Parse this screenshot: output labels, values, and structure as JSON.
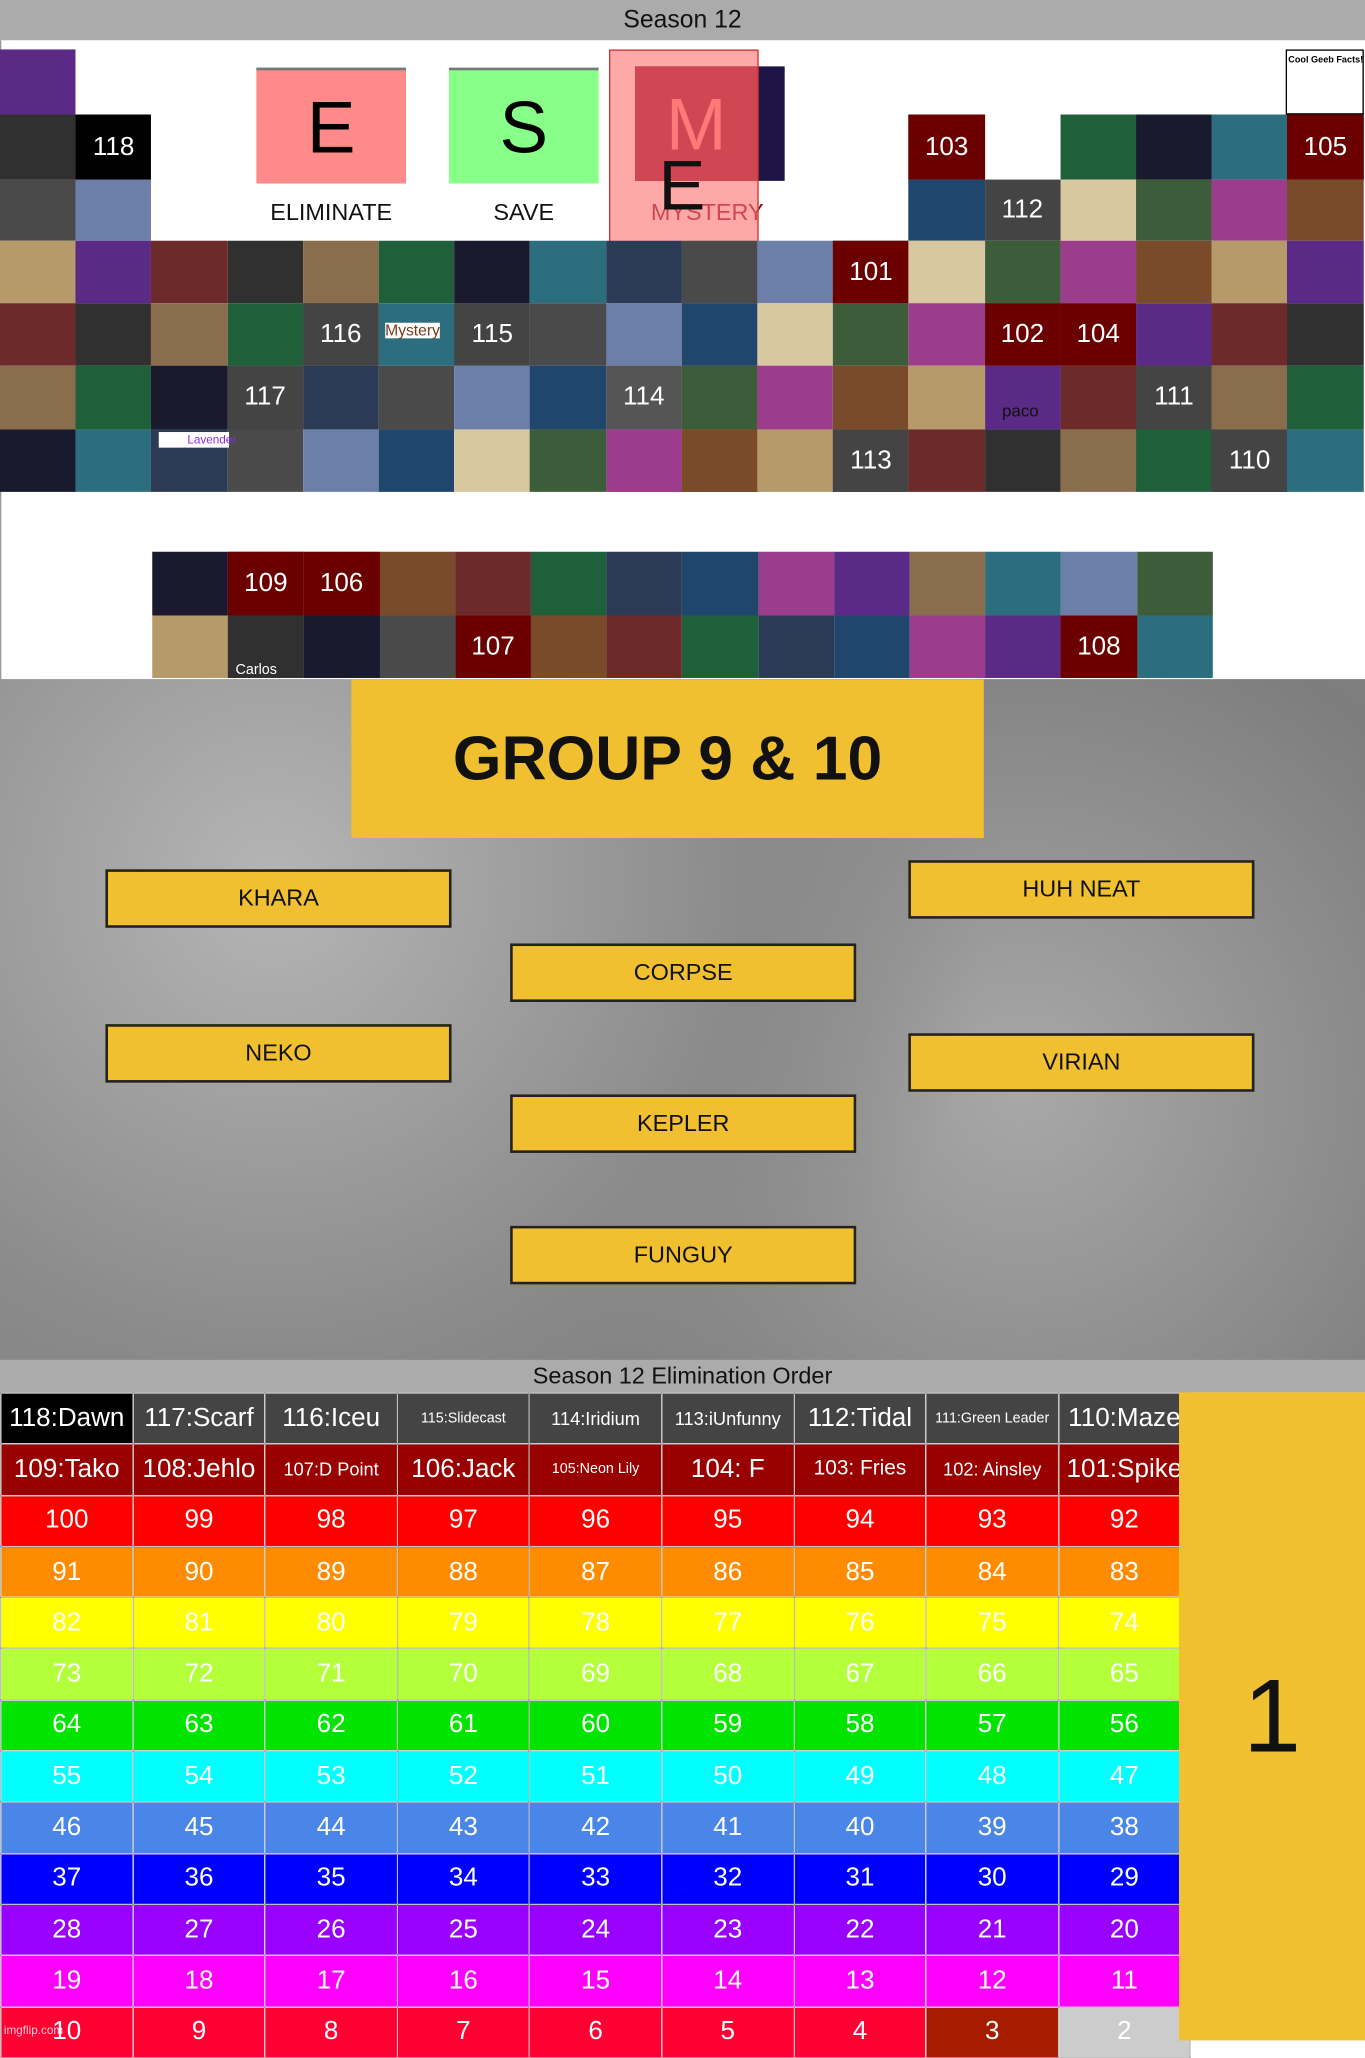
{
  "header": {
    "title": "Season 12"
  },
  "legend": {
    "eliminate": {
      "letter": "E",
      "label": "ELIMINATE",
      "color": "#ff8a8a"
    },
    "save": {
      "letter": "S",
      "label": "SAVE",
      "color": "#88ff88"
    },
    "mystery": {
      "letter": "M",
      "overlay_letter": "E",
      "label": "MYSTERY",
      "color": "#8b0a2a"
    }
  },
  "board_tiles": [
    {
      "label": "118",
      "row": 1,
      "col": 1,
      "color": "#000000"
    },
    {
      "label": "103",
      "row": 1,
      "col": 12,
      "color": "#6b0000"
    },
    {
      "label": "105",
      "row": 1,
      "col": 17,
      "color": "#6b0000"
    },
    {
      "label": "112",
      "row": 2,
      "col": 13,
      "color": "#444444"
    },
    {
      "label": "101",
      "row": 3,
      "col": 11,
      "color": "#6b0000"
    },
    {
      "label": "116",
      "row": 4,
      "col": 4,
      "color": "#444444"
    },
    {
      "label": "115",
      "row": 4,
      "col": 6,
      "color": "#444444"
    },
    {
      "label": "102",
      "row": 4,
      "col": 13,
      "color": "#6b0000"
    },
    {
      "label": "104",
      "row": 4,
      "col": 14,
      "color": "#6b0000"
    },
    {
      "label": "117",
      "row": 5,
      "col": 3,
      "color": "#444444"
    },
    {
      "label": "114",
      "row": 5,
      "col": 8,
      "color": "#555555"
    },
    {
      "label": "111",
      "row": 5,
      "col": 15,
      "color": "#444444"
    },
    {
      "label": "113",
      "row": 6,
      "col": 11,
      "color": "#444444"
    },
    {
      "label": "110",
      "row": 6,
      "col": 16,
      "color": "#444444"
    }
  ],
  "lower_tiles": [
    {
      "label": "109",
      "row": 0,
      "col": 3,
      "color": "#6b0000"
    },
    {
      "label": "106",
      "row": 0,
      "col": 4,
      "color": "#6b0000"
    },
    {
      "label": "107",
      "row": 1,
      "col": 6,
      "color": "#6b0000"
    },
    {
      "label": "108",
      "row": 1,
      "col": 14,
      "color": "#6b0000"
    }
  ],
  "image_tile_captions": [
    "Cool Geeb Facts!",
    "Lavender",
    "Mystery",
    "paco",
    "Carlos"
  ],
  "group": {
    "title": "GROUP 9 & 10",
    "members": [
      "KHARA",
      "HUH NEAT",
      "CORPSE",
      "NEKO",
      "VIRIAN",
      "KEPLER",
      "FUNGUY"
    ]
  },
  "elimination": {
    "title": "Season 12 Elimination Order",
    "eliminated_row1": [
      "118:Dawn",
      "117:Scarf",
      "116:Iceu",
      "115:Slidecast",
      "114:Iridium",
      "113:iUnfunny",
      "112:Tidal",
      "111:Green Leader",
      "110:Maze"
    ],
    "eliminated_row2": [
      "109:Tako",
      "108:Jehlo",
      "107:D Point",
      "106:Jack",
      "105:Neon Lily",
      "104: F",
      "103: Fries",
      "102: Ainsley",
      "101:Spike"
    ],
    "places": [
      [
        100,
        99,
        98,
        97,
        96,
        95,
        94,
        93,
        92
      ],
      [
        91,
        90,
        89,
        88,
        87,
        86,
        85,
        84,
        83
      ],
      [
        82,
        81,
        80,
        79,
        78,
        77,
        76,
        75,
        74
      ],
      [
        73,
        72,
        71,
        70,
        69,
        68,
        67,
        66,
        65
      ],
      [
        64,
        63,
        62,
        61,
        60,
        59,
        58,
        57,
        56
      ],
      [
        55,
        54,
        53,
        52,
        51,
        50,
        49,
        48,
        47
      ],
      [
        46,
        45,
        44,
        43,
        42,
        41,
        40,
        39,
        38
      ],
      [
        37,
        36,
        35,
        34,
        33,
        32,
        31,
        30,
        29
      ],
      [
        28,
        27,
        26,
        25,
        24,
        23,
        22,
        21,
        20
      ],
      [
        19,
        18,
        17,
        16,
        15,
        14,
        13,
        12,
        11
      ],
      [
        10,
        9,
        8,
        7,
        6,
        5,
        4,
        3,
        2
      ]
    ],
    "row_colors": [
      "#ff0000",
      "#ff8c00",
      "#ffff00",
      "#b3ff3a",
      "#00e400",
      "#00ffff",
      "#4a86e8",
      "#0000ff",
      "#9a00ff",
      "#ff00ff",
      "#ff0033"
    ],
    "special_cells": {
      "3": "#a61c00",
      "2": "#cccccc"
    },
    "winner": "1",
    "winner_color": "#f0c030"
  },
  "watermark": "imgflip.com"
}
